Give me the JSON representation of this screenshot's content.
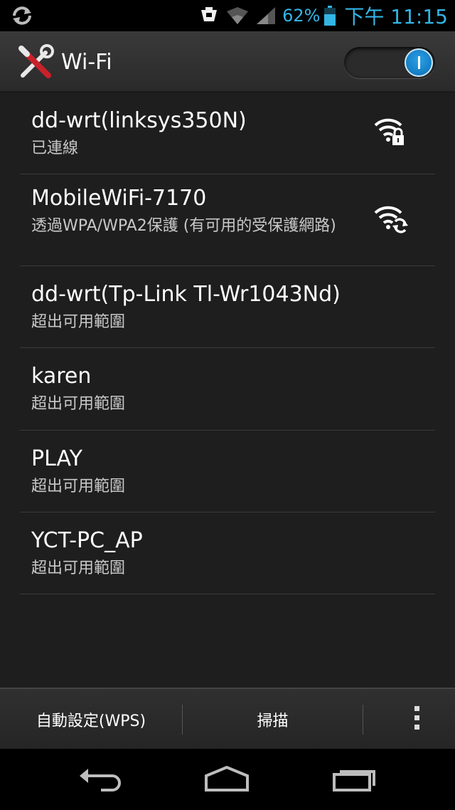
{
  "status_bar": {
    "battery_percent": "62%",
    "time": "下午 11:15",
    "icons": [
      "sync-icon",
      "usb-debug-icon",
      "wifi-signal-icon",
      "cell-signal-icon",
      "battery-icon"
    ]
  },
  "header": {
    "title": "Wi-Fi",
    "toggle_on": true
  },
  "networks": [
    {
      "name": "dd-wrt(linksys350N)",
      "status": "已連線",
      "signal_icon": "wifi-lock-icon"
    },
    {
      "name": "MobileWiFi-7170",
      "status": "透過WPA/WPA2保護 (有可用的受保護網路)",
      "signal_icon": "wifi-wps-icon"
    },
    {
      "name": "dd-wrt(Tp-Link Tl-Wr1043Nd)",
      "status": "超出可用範圍"
    },
    {
      "name": "karen",
      "status": "超出可用範圍"
    },
    {
      "name": "PLAY",
      "status": "超出可用範圍"
    },
    {
      "name": "YCT-PC_AP",
      "status": "超出可用範圍"
    }
  ],
  "action_bar": {
    "wps_label": "自動設定(WPS)",
    "scan_label": "掃描"
  },
  "colors": {
    "accent": "#33b5e5",
    "list_bg": "#1e1e1e",
    "toggle_blue": "#0b6fb5"
  }
}
